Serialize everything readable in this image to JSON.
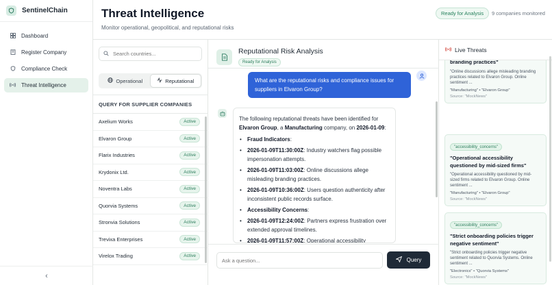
{
  "brand": {
    "name": "SentinelChain",
    "logo_icon": "shield-icon"
  },
  "nav": {
    "items": [
      {
        "label": "Dashboard",
        "icon": "grid-icon"
      },
      {
        "label": "Register Company",
        "icon": "building-icon"
      },
      {
        "label": "Compliance Check",
        "icon": "shield-check-icon"
      },
      {
        "label": "Threat Intelligence",
        "icon": "radio-icon",
        "active": true
      }
    ],
    "collapse_glyph": "‹"
  },
  "header": {
    "title": "Threat Intelligence",
    "subtitle": "Monitor operational, geopolitical, and reputational risks",
    "status": "Ready for Analysis",
    "companies_count": "9 companies monitored"
  },
  "countries": {
    "search_placeholder": "Search countries...",
    "segments": [
      {
        "label": "Operational",
        "icon": "globe-icon"
      },
      {
        "label": "Reputational",
        "icon": "activity-icon",
        "active": true
      }
    ],
    "query_header": "QUERY FOR SUPPLIER COMPANIES",
    "companies": [
      {
        "name": "Axelium Works",
        "status": "Active"
      },
      {
        "name": "Elvaron Group",
        "status": "Active"
      },
      {
        "name": "Flarix Industries",
        "status": "Active"
      },
      {
        "name": "Krydonix Ltd.",
        "status": "Active"
      },
      {
        "name": "Noventra Labs",
        "status": "Active"
      },
      {
        "name": "Quorvia Systems",
        "status": "Active"
      },
      {
        "name": "Stronvia Solutions",
        "status": "Active"
      },
      {
        "name": "Trevixa Enterprises",
        "status": "Active"
      },
      {
        "name": "Virelox Trading",
        "status": "Active"
      }
    ]
  },
  "chat": {
    "title": "Reputational Risk Analysis",
    "status": "Ready for Analysis",
    "user_message": "What are the reputational risks and compliance issues for suppliers in Elvaron Group?",
    "bot": {
      "intro_a": "The following reputational threats have been identified for ",
      "company": "Elvaron Group",
      "intro_b": ", a ",
      "industry": "Manufacturing",
      "intro_c": " company, on ",
      "date": "2026-01-09",
      "intro_d": ":",
      "sections": [
        {
          "heading": "Fraud Indicators",
          "colon": ":"
        },
        {
          "heading": "Accessibility Concerns",
          "colon": ":"
        }
      ],
      "fraud_items": [
        {
          "ts": "2026-01-09T11:30:00Z",
          "text": ": Industry watchers flag possible impersonation attempts."
        },
        {
          "ts": "2026-01-09T11:03:00Z",
          "text": ": Online discussions allege misleading branding practices."
        },
        {
          "ts": "2026-01-09T10:36:00Z",
          "text": ": Users question authenticity after inconsistent public records surface."
        }
      ],
      "access_items": [
        {
          "ts": "2026-01-09T12:24:00Z",
          "text": ": Partners express frustration over extended approval timelines."
        },
        {
          "ts": "2026-01-09T11:57:00Z",
          "text": ": Operational accessibility"
        }
      ]
    },
    "input_placeholder": "Ask a question...",
    "query_label": "Query"
  },
  "live": {
    "title": "Live Threats",
    "threats": [
      {
        "tag": "",
        "title": "branding practices\"",
        "desc": "\"Online discussions allege misleading branding practices related to Elvaron Group. Online sentiment ...",
        "meta": "\"Manufacturing\" • \"Elvaron Group\"",
        "source": "Source: \"MockNews\""
      },
      {
        "tag": "\"accessibility_concerns\"",
        "title": "\"Operational accessibility questioned by mid-sized firms\"",
        "desc": "\"Operational accessibility questioned by mid-sized firms related to Elvaron Group. Online sentiment ...",
        "meta": "\"Manufacturing\" • \"Elvaron Group\"",
        "source": "Source: \"MockNews\""
      },
      {
        "tag": "\"accessibility_concerns\"",
        "title": "\"Strict onboarding policies trigger negative sentiment\"",
        "desc": "\"Strict onboarding policies trigger negative sentiment related to Quorvia Systems. Online sentiment ...",
        "meta": "\"Electronics\" • \"Quorvia Systems\"",
        "source": "Source: \"MockNews\""
      }
    ]
  }
}
